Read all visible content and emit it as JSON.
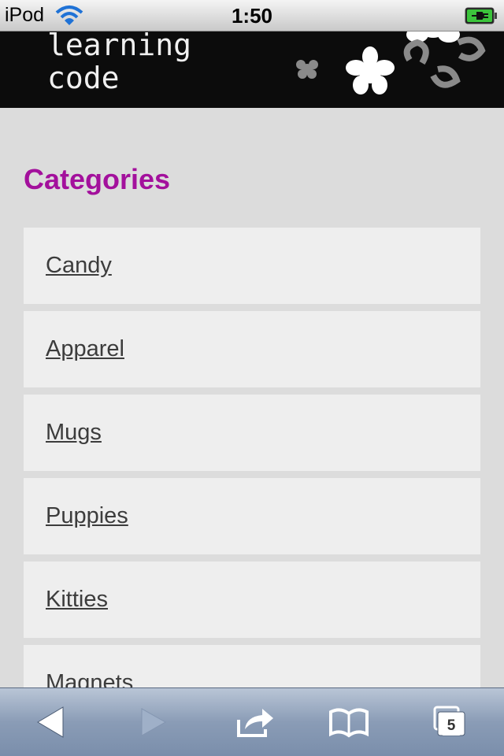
{
  "status_bar": {
    "carrier": "iPod",
    "time": "1:50",
    "wifi_icon": "wifi-icon",
    "battery_icon": "battery-charging-icon"
  },
  "header": {
    "logo_line1": "learning",
    "logo_line2": "code",
    "decoration": "flower-decoration"
  },
  "page": {
    "heading": "Categories",
    "heading_color": "#a3109c",
    "categories": [
      {
        "label": "Candy"
      },
      {
        "label": "Apparel"
      },
      {
        "label": "Mugs"
      },
      {
        "label": "Puppies"
      },
      {
        "label": "Kitties"
      },
      {
        "label": "Magnets"
      }
    ]
  },
  "toolbar": {
    "back_icon": "back-arrow-icon",
    "forward_icon": "forward-arrow-icon",
    "share_icon": "share-icon",
    "bookmarks_icon": "bookmarks-book-icon",
    "tabs_icon": "tabs-icon",
    "tabs_count": "5"
  }
}
